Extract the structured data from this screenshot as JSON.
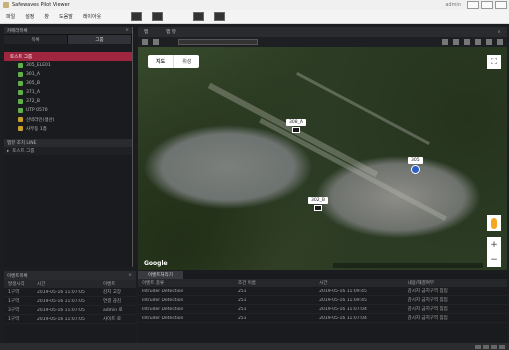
{
  "window": {
    "title": "Safewaves Pilot Viewer",
    "title_right": "admin"
  },
  "menu": {
    "items": [
      "파일",
      "설정",
      "창",
      "도움말",
      "레이아웃"
    ]
  },
  "left_panel": {
    "header": "카메라목록",
    "tabs": [
      "목록",
      "그룹"
    ],
    "tree_root": "토스트 그룹",
    "tree_items": [
      {
        "label": "305_ELE01",
        "icon": "camera-icon"
      },
      {
        "label": "301_A",
        "icon": "camera-icon"
      },
      {
        "label": "305_B",
        "icon": "camera-icon"
      },
      {
        "label": "371_A",
        "icon": "camera-icon"
      },
      {
        "label": "372_B",
        "icon": "camera-icon"
      },
      {
        "label": "UTP 0570",
        "icon": "camera-icon"
      },
      {
        "label": "선박라인(생산)",
        "icon": "folder-icon"
      },
      {
        "label": "사무동 1층",
        "icon": "folder-icon"
      }
    ],
    "lower_header": "맵뷰 조치 LINE",
    "lower_item": "토스트 그룹"
  },
  "map": {
    "tab_label": "맵",
    "tab2_label": "맵 뷰",
    "map_type": {
      "map": "지도",
      "satellite": "위성"
    },
    "markers": [
      {
        "label": "308_A"
      },
      {
        "label": "305"
      },
      {
        "label": "302_B"
      }
    ],
    "google": "Google"
  },
  "bottom_left": {
    "header": "이벤트목록",
    "columns": [
      "발생시각",
      "시간",
      "이벤트"
    ],
    "rows": [
      [
        "1구역",
        "2019-05-16 11:07:05",
        "감지 고장"
      ],
      [
        "1구역",
        "2019-05-16 11:07:05",
        "연결 끊김"
      ],
      [
        "3구역",
        "2019-05-16 11:07:05",
        "admin 로"
      ],
      [
        "1구역",
        "2019-05-16 11:07:05",
        "사이트 로"
      ]
    ]
  },
  "bottom_right": {
    "tab": "이벤트처리기",
    "columns": [
      "이벤트 종류",
      "조건 이름",
      "시간",
      "내용/해결여부"
    ],
    "rows": [
      [
        "Intruder Detection",
        "251",
        "2019-05-16 11:09:45",
        "감시지 금지구역 침입"
      ],
      [
        "Intruder Detection",
        "251",
        "2019-05-16 11:09:45",
        "감시지 금지구역 침입"
      ],
      [
        "Intruder Detection",
        "251",
        "2019-05-16 11:07:04",
        "감시지 금지구역 침입"
      ],
      [
        "Intruder Detection",
        "251",
        "2019-05-16 11:07:04",
        "감시지 금지구역 침입"
      ]
    ]
  }
}
